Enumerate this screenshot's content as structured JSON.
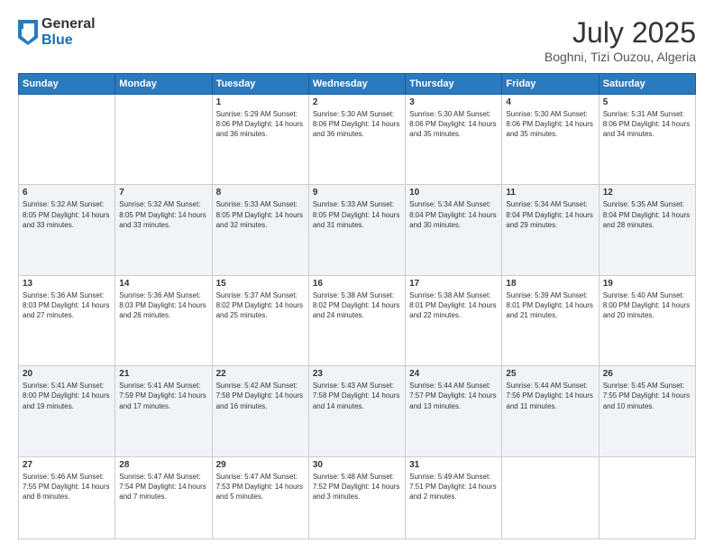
{
  "header": {
    "logo": {
      "general": "General",
      "blue": "Blue"
    },
    "title": "July 2025",
    "location": "Boghni, Tizi Ouzou, Algeria"
  },
  "weekdays": [
    "Sunday",
    "Monday",
    "Tuesday",
    "Wednesday",
    "Thursday",
    "Friday",
    "Saturday"
  ],
  "weeks": [
    [
      {
        "day": "",
        "detail": ""
      },
      {
        "day": "",
        "detail": ""
      },
      {
        "day": "1",
        "detail": "Sunrise: 5:29 AM\nSunset: 8:06 PM\nDaylight: 14 hours\nand 36 minutes."
      },
      {
        "day": "2",
        "detail": "Sunrise: 5:30 AM\nSunset: 8:06 PM\nDaylight: 14 hours\nand 36 minutes."
      },
      {
        "day": "3",
        "detail": "Sunrise: 5:30 AM\nSunset: 8:06 PM\nDaylight: 14 hours\nand 35 minutes."
      },
      {
        "day": "4",
        "detail": "Sunrise: 5:30 AM\nSunset: 8:06 PM\nDaylight: 14 hours\nand 35 minutes."
      },
      {
        "day": "5",
        "detail": "Sunrise: 5:31 AM\nSunset: 8:06 PM\nDaylight: 14 hours\nand 34 minutes."
      }
    ],
    [
      {
        "day": "6",
        "detail": "Sunrise: 5:32 AM\nSunset: 8:05 PM\nDaylight: 14 hours\nand 33 minutes."
      },
      {
        "day": "7",
        "detail": "Sunrise: 5:32 AM\nSunset: 8:05 PM\nDaylight: 14 hours\nand 33 minutes."
      },
      {
        "day": "8",
        "detail": "Sunrise: 5:33 AM\nSunset: 8:05 PM\nDaylight: 14 hours\nand 32 minutes."
      },
      {
        "day": "9",
        "detail": "Sunrise: 5:33 AM\nSunset: 8:05 PM\nDaylight: 14 hours\nand 31 minutes."
      },
      {
        "day": "10",
        "detail": "Sunrise: 5:34 AM\nSunset: 8:04 PM\nDaylight: 14 hours\nand 30 minutes."
      },
      {
        "day": "11",
        "detail": "Sunrise: 5:34 AM\nSunset: 8:04 PM\nDaylight: 14 hours\nand 29 minutes."
      },
      {
        "day": "12",
        "detail": "Sunrise: 5:35 AM\nSunset: 8:04 PM\nDaylight: 14 hours\nand 28 minutes."
      }
    ],
    [
      {
        "day": "13",
        "detail": "Sunrise: 5:36 AM\nSunset: 8:03 PM\nDaylight: 14 hours\nand 27 minutes."
      },
      {
        "day": "14",
        "detail": "Sunrise: 5:36 AM\nSunset: 8:03 PM\nDaylight: 14 hours\nand 26 minutes."
      },
      {
        "day": "15",
        "detail": "Sunrise: 5:37 AM\nSunset: 8:02 PM\nDaylight: 14 hours\nand 25 minutes."
      },
      {
        "day": "16",
        "detail": "Sunrise: 5:38 AM\nSunset: 8:02 PM\nDaylight: 14 hours\nand 24 minutes."
      },
      {
        "day": "17",
        "detail": "Sunrise: 5:38 AM\nSunset: 8:01 PM\nDaylight: 14 hours\nand 22 minutes."
      },
      {
        "day": "18",
        "detail": "Sunrise: 5:39 AM\nSunset: 8:01 PM\nDaylight: 14 hours\nand 21 minutes."
      },
      {
        "day": "19",
        "detail": "Sunrise: 5:40 AM\nSunset: 8:00 PM\nDaylight: 14 hours\nand 20 minutes."
      }
    ],
    [
      {
        "day": "20",
        "detail": "Sunrise: 5:41 AM\nSunset: 8:00 PM\nDaylight: 14 hours\nand 19 minutes."
      },
      {
        "day": "21",
        "detail": "Sunrise: 5:41 AM\nSunset: 7:59 PM\nDaylight: 14 hours\nand 17 minutes."
      },
      {
        "day": "22",
        "detail": "Sunrise: 5:42 AM\nSunset: 7:58 PM\nDaylight: 14 hours\nand 16 minutes."
      },
      {
        "day": "23",
        "detail": "Sunrise: 5:43 AM\nSunset: 7:58 PM\nDaylight: 14 hours\nand 14 minutes."
      },
      {
        "day": "24",
        "detail": "Sunrise: 5:44 AM\nSunset: 7:57 PM\nDaylight: 14 hours\nand 13 minutes."
      },
      {
        "day": "25",
        "detail": "Sunrise: 5:44 AM\nSunset: 7:56 PM\nDaylight: 14 hours\nand 11 minutes."
      },
      {
        "day": "26",
        "detail": "Sunrise: 5:45 AM\nSunset: 7:55 PM\nDaylight: 14 hours\nand 10 minutes."
      }
    ],
    [
      {
        "day": "27",
        "detail": "Sunrise: 5:46 AM\nSunset: 7:55 PM\nDaylight: 14 hours\nand 8 minutes."
      },
      {
        "day": "28",
        "detail": "Sunrise: 5:47 AM\nSunset: 7:54 PM\nDaylight: 14 hours\nand 7 minutes."
      },
      {
        "day": "29",
        "detail": "Sunrise: 5:47 AM\nSunset: 7:53 PM\nDaylight: 14 hours\nand 5 minutes."
      },
      {
        "day": "30",
        "detail": "Sunrise: 5:48 AM\nSunset: 7:52 PM\nDaylight: 14 hours\nand 3 minutes."
      },
      {
        "day": "31",
        "detail": "Sunrise: 5:49 AM\nSunset: 7:51 PM\nDaylight: 14 hours\nand 2 minutes."
      },
      {
        "day": "",
        "detail": ""
      },
      {
        "day": "",
        "detail": ""
      }
    ]
  ]
}
